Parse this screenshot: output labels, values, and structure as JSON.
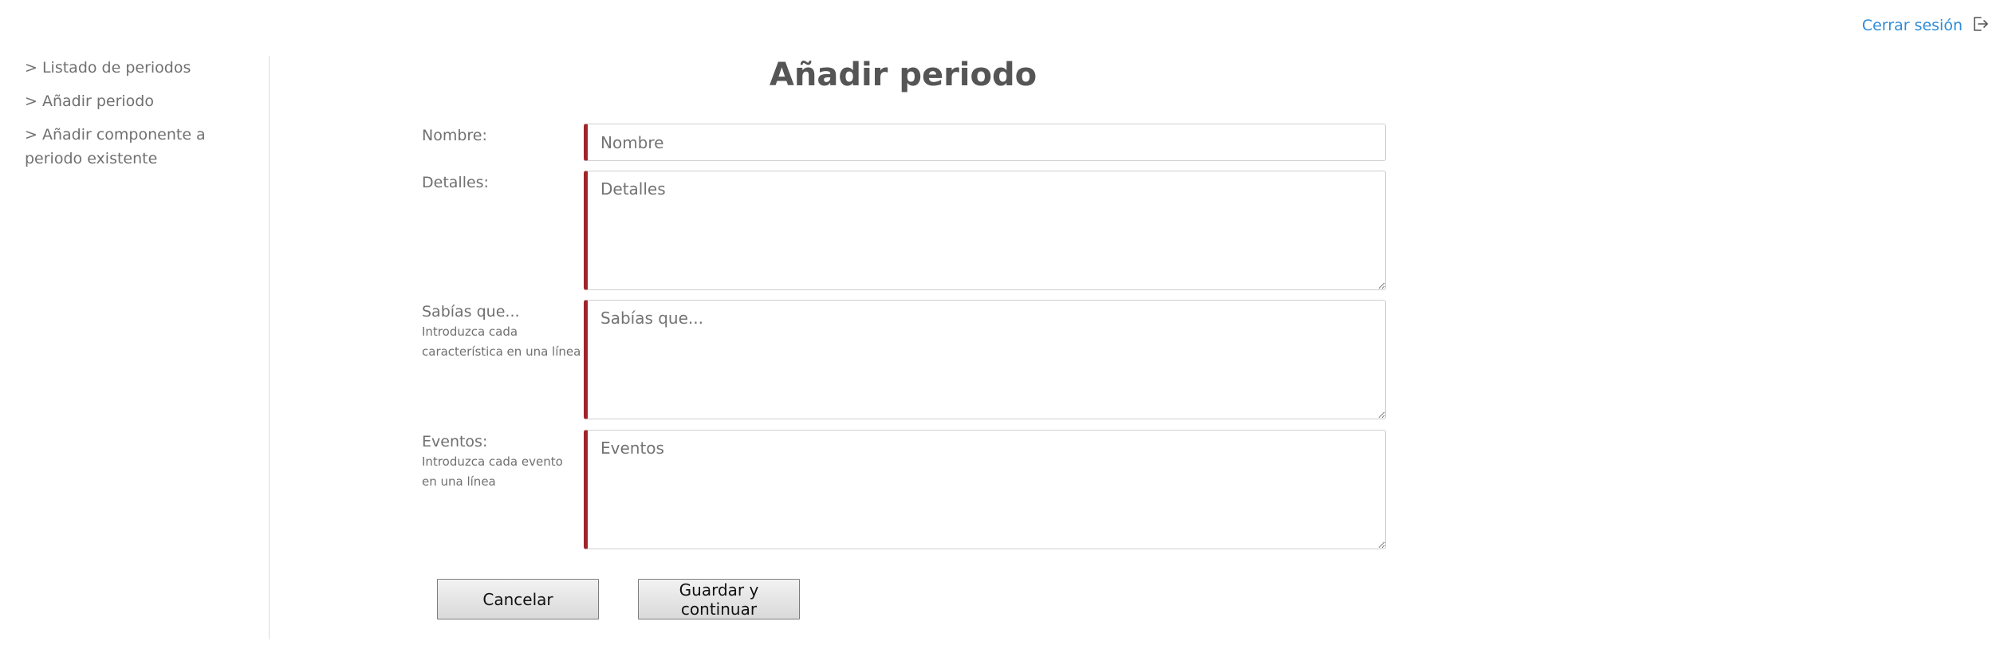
{
  "header": {
    "logout_label": "Cerrar sesión",
    "logout_icon": "logout-icon"
  },
  "sidebar": {
    "items": [
      {
        "label": "> Listado de periodos"
      },
      {
        "label": "> Añadir periodo"
      },
      {
        "label": "> Añadir componente a periodo existente"
      }
    ]
  },
  "main": {
    "title": "Añadir periodo",
    "form": {
      "nombre": {
        "label": "Nombre:",
        "placeholder": "Nombre",
        "value": ""
      },
      "detalles": {
        "label": "Detalles:",
        "placeholder": "Detalles",
        "value": ""
      },
      "sabias": {
        "label": "Sabías que...",
        "hint": "Introduzca cada característica en una línea",
        "placeholder": "Sabías que...",
        "value": ""
      },
      "eventos": {
        "label": "Eventos:",
        "hint": "Introduzca cada evento en una línea",
        "placeholder": "Eventos",
        "value": ""
      }
    },
    "buttons": {
      "cancel_label": "Cancelar",
      "save_label": "Guardar y continuar"
    }
  },
  "colors": {
    "link": "#2e8bd8",
    "required_accent": "#a0252a",
    "text": "#707070"
  }
}
